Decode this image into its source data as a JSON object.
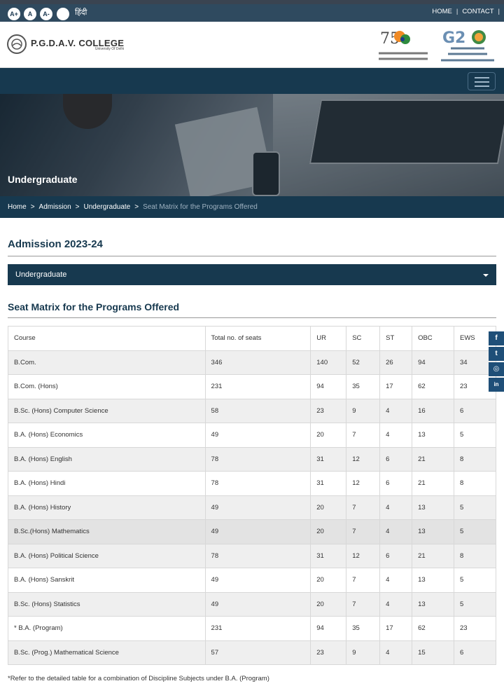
{
  "accessibility": {
    "increase": "A+",
    "normal": "A",
    "decrease": "A-",
    "contrast_icon": "half-moon-icon",
    "language": "हिंदी"
  },
  "top_links": {
    "home": "HOME",
    "contact": "CONTACT",
    "separator": "|"
  },
  "college": {
    "name": "P.G.D.A.V. COLLEGE",
    "subtitle": "University Of Delhi"
  },
  "banner": {
    "title": "Undergraduate"
  },
  "breadcrumb": {
    "items": [
      "Home",
      "Admission",
      "Undergraduate"
    ],
    "current": "Seat Matrix for the Programs Offered",
    "separator": ">"
  },
  "admission_heading": "Admission 2023-24",
  "program_select": {
    "selected": "Undergraduate"
  },
  "seat_matrix": {
    "heading": "Seat Matrix for the Programs Offered",
    "columns": [
      "Course",
      "Total no. of seats",
      "UR",
      "SC",
      "ST",
      "OBC",
      "EWS"
    ],
    "rows": [
      [
        "B.Com.",
        "346",
        "140",
        "52",
        "26",
        "94",
        "34"
      ],
      [
        "B.Com. (Hons)",
        "231",
        "94",
        "35",
        "17",
        "62",
        "23"
      ],
      [
        "B.Sc. (Hons) Computer Science",
        "58",
        "23",
        "9",
        "4",
        "16",
        "6"
      ],
      [
        "B.A. (Hons) Economics",
        "49",
        "20",
        "7",
        "4",
        "13",
        "5"
      ],
      [
        "B.A. (Hons) English",
        "78",
        "31",
        "12",
        "6",
        "21",
        "8"
      ],
      [
        "B.A. (Hons) Hindi",
        "78",
        "31",
        "12",
        "6",
        "21",
        "8"
      ],
      [
        "B.A. (Hons) History",
        "49",
        "20",
        "7",
        "4",
        "13",
        "5"
      ],
      [
        "B.Sc.(Hons) Mathematics",
        "49",
        "20",
        "7",
        "4",
        "13",
        "5"
      ],
      [
        "B.A. (Hons) Political Science",
        "78",
        "31",
        "12",
        "6",
        "21",
        "8"
      ],
      [
        "B.A. (Hons) Sanskrit",
        "49",
        "20",
        "7",
        "4",
        "13",
        "5"
      ],
      [
        "B.Sc. (Hons) Statistics",
        "49",
        "20",
        "7",
        "4",
        "13",
        "5"
      ],
      [
        "* B.A. (Program)",
        "231",
        "94",
        "35",
        "17",
        "62",
        "23"
      ],
      [
        "B.Sc. (Prog.) Mathematical Science",
        "57",
        "23",
        "9",
        "4",
        "15",
        "6"
      ]
    ],
    "footnote": "*Refer to the detailed table for a combination of Discipline Subjects under B.A. (Program)"
  },
  "social": [
    {
      "icon": "facebook-icon",
      "glyph": "f"
    },
    {
      "icon": "twitter-icon",
      "glyph": "t"
    },
    {
      "icon": "instagram-icon",
      "glyph": "◎"
    },
    {
      "icon": "linkedin-icon",
      "glyph": "in"
    }
  ],
  "colors": {
    "navy": "#17394f",
    "utility_bar": "#2f4a5f",
    "social": "#1f4f78"
  }
}
